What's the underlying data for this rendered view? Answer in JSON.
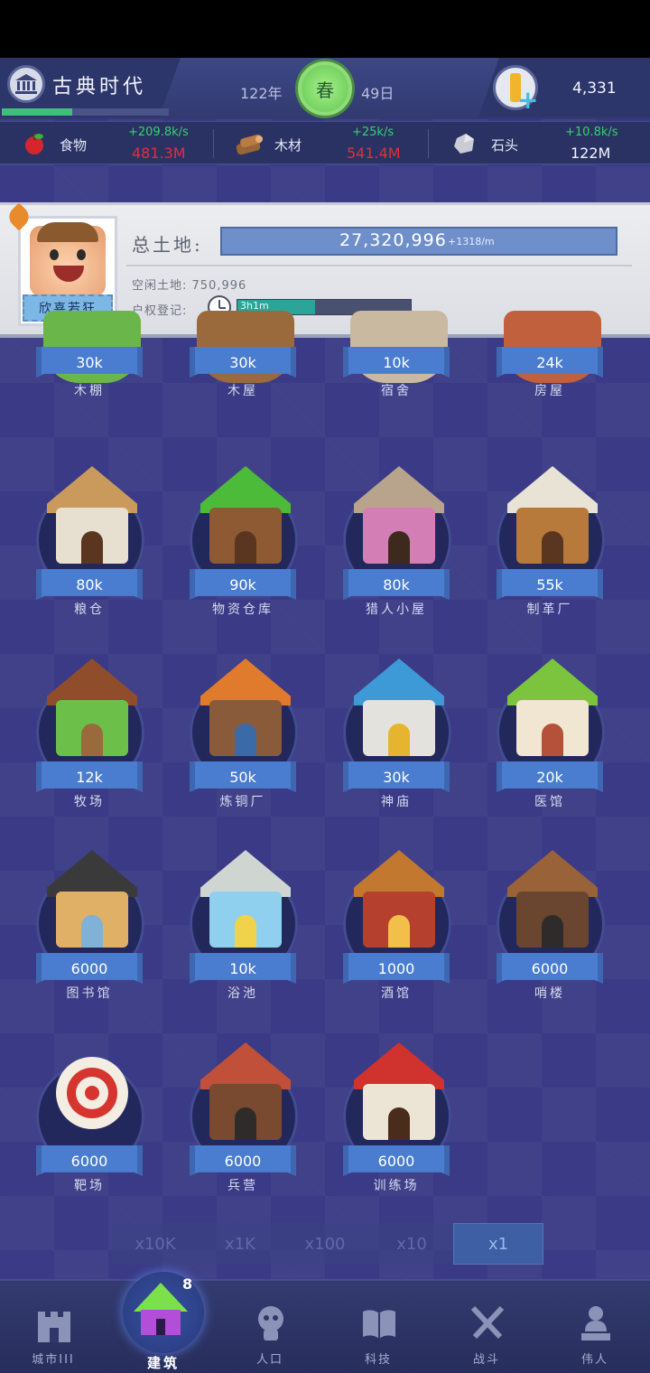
{
  "header": {
    "era_title": "古典时代",
    "era_progress": 0.42,
    "year": "122年",
    "season": "春",
    "day": "49日",
    "gold": "4,331"
  },
  "resources": [
    {
      "name": "食物",
      "rate": "+209.8k/s",
      "amount": "481.3M",
      "icon": "apple-icon",
      "amount_color": "#e0303a"
    },
    {
      "name": "木材",
      "rate": "+25k/s",
      "amount": "541.4M",
      "icon": "wood-log-icon",
      "amount_color": "#e0303a"
    },
    {
      "name": "石头",
      "rate": "+10.8k/s",
      "amount": "122M",
      "icon": "stone-icon",
      "amount_color": "#f2f4fb"
    }
  ],
  "land": {
    "avatar_title": "欣喜若狂",
    "total_label": "总土地:",
    "total_value": "27,320,996",
    "total_rate": "+1318/m",
    "free_land": "空闲土地: 750,996",
    "registration_label": "户权登记:",
    "registration_time": "3h1m",
    "registration_progress": 0.45
  },
  "buildings_partial": [
    {
      "name": "木棚",
      "cost": "30k"
    },
    {
      "name": "木屋",
      "cost": "30k"
    },
    {
      "name": "宿舍",
      "cost": "10k"
    },
    {
      "name": "房屋",
      "cost": "24k"
    }
  ],
  "buildings": [
    {
      "name": "粮仓",
      "cost": "80k"
    },
    {
      "name": "物资仓库",
      "cost": "90k"
    },
    {
      "name": "猎人小屋",
      "cost": "80k"
    },
    {
      "name": "制革厂",
      "cost": "55k"
    },
    {
      "name": "牧场",
      "cost": "12k"
    },
    {
      "name": "炼铜厂",
      "cost": "50k"
    },
    {
      "name": "神庙",
      "cost": "30k"
    },
    {
      "name": "医馆",
      "cost": "20k"
    },
    {
      "name": "图书馆",
      "cost": "6000"
    },
    {
      "name": "浴池",
      "cost": "10k"
    },
    {
      "name": "酒馆",
      "cost": "1000"
    },
    {
      "name": "哨楼",
      "cost": "6000"
    },
    {
      "name": "靶场",
      "cost": "6000"
    },
    {
      "name": "兵营",
      "cost": "6000"
    },
    {
      "name": "训练场",
      "cost": "6000"
    }
  ],
  "multipliers": [
    "x10K",
    "x1K",
    "x100",
    "x10",
    "x1"
  ],
  "multiplier_selected": "x1",
  "nav": {
    "city": "城市III",
    "build": "建筑",
    "build_badge": "8",
    "population": "人口",
    "tech": "科技",
    "battle": "战斗",
    "greats": "伟人"
  }
}
